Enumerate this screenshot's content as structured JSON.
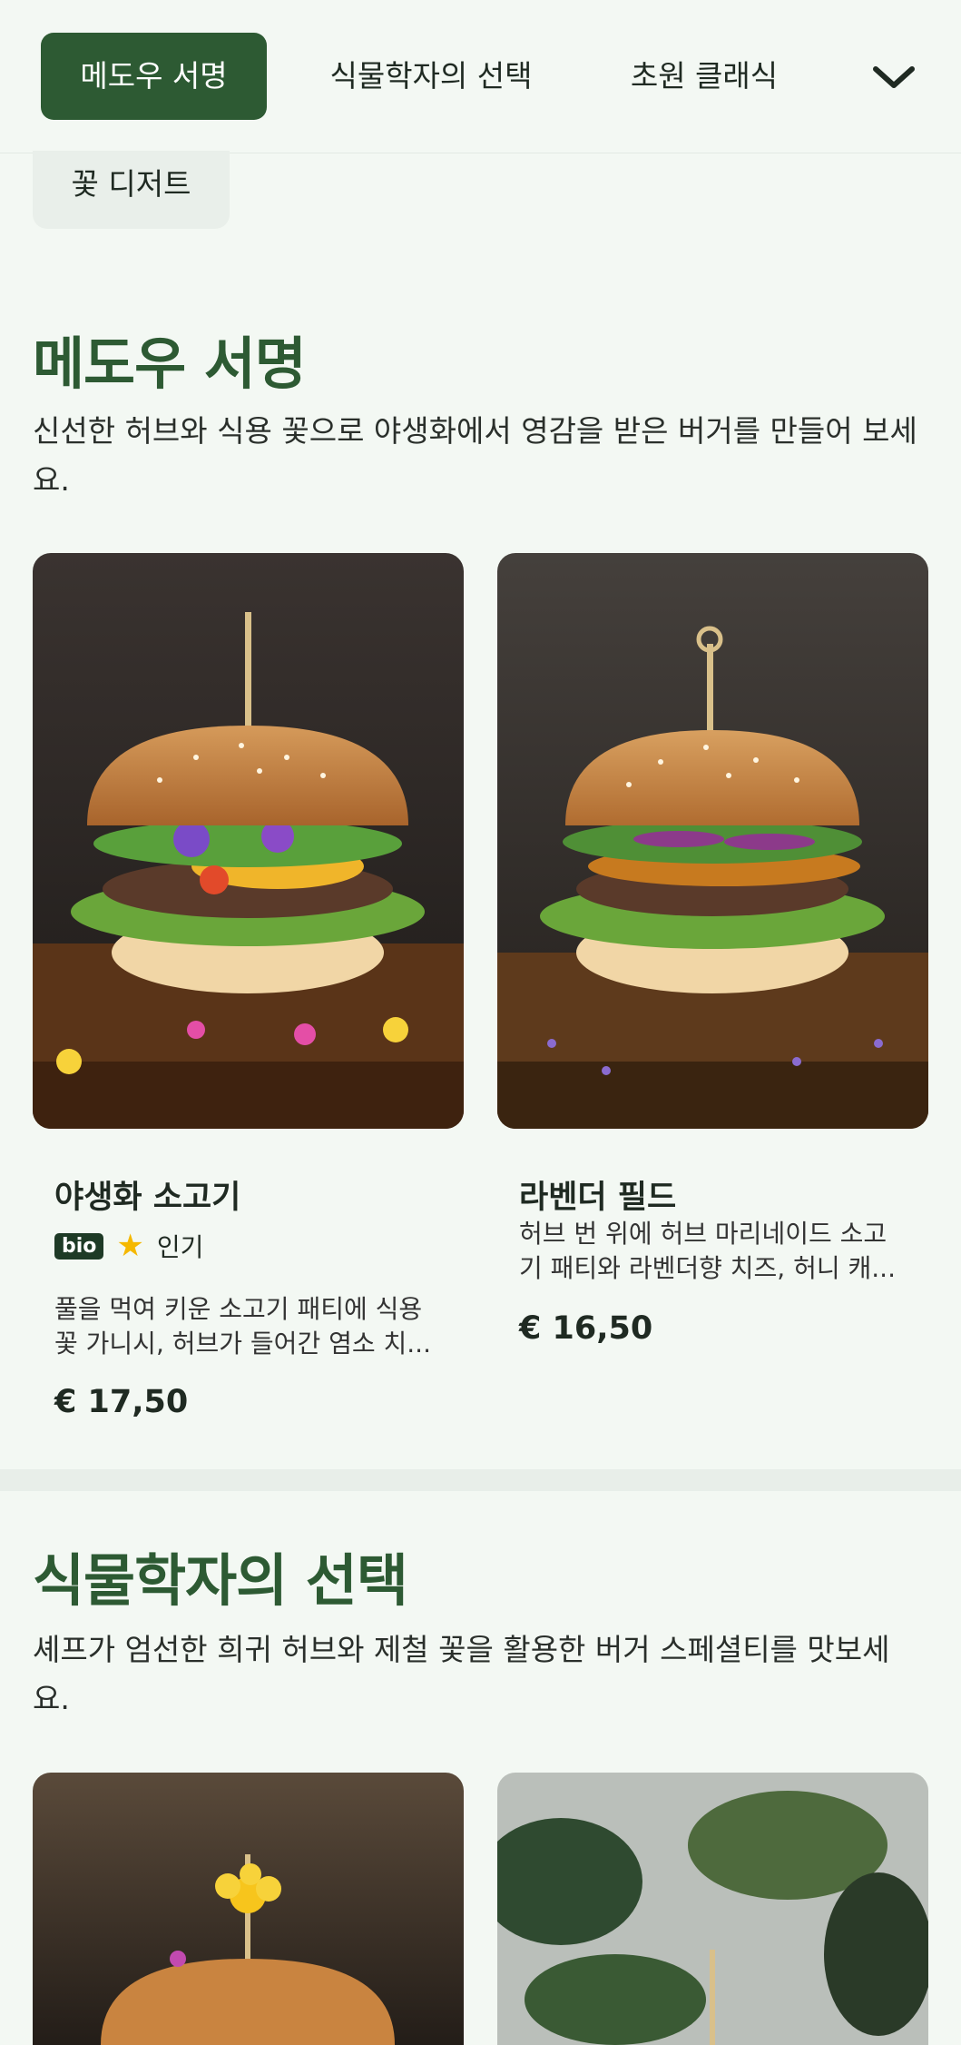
{
  "nav": {
    "tabs": [
      {
        "label": "메도우 서명",
        "active": true
      },
      {
        "label": "식물학자의 선택",
        "active": false
      },
      {
        "label": "초원 클래식",
        "active": false
      }
    ],
    "more_icon": "chevron-down-icon",
    "extra_chip": "꽃 디저트"
  },
  "sections": [
    {
      "title": "메도우 서명",
      "description": "신선한 허브와 식용 꽃으로 야생화에서 영감을 받은 버거를 만들어 보세요.",
      "items": [
        {
          "name": "야생화 소고기",
          "badge": "bio",
          "popular_label": "인기",
          "description": "풀을 먹여 키운 소고기 패티에 식용 꽃 가니시, 허브가 들어간 염소 치...",
          "price": "€ 17,50"
        },
        {
          "name": "라벤더 필드",
          "description": "허브 번 위에 허브 마리네이드 소고기 패티와 라벤더향 치즈, 허니 캐...",
          "price": "€ 16,50"
        }
      ]
    },
    {
      "title": "식물학자의 선택",
      "description": "셰프가 엄선한 희귀 허브와 제철 꽃을 활용한 버거 스페셜티를 맛보세요."
    }
  ],
  "colors": {
    "brand": "#2d5a33",
    "background": "#f3f8f3",
    "star": "#f5b800",
    "bio_badge": "#1e3a26"
  }
}
